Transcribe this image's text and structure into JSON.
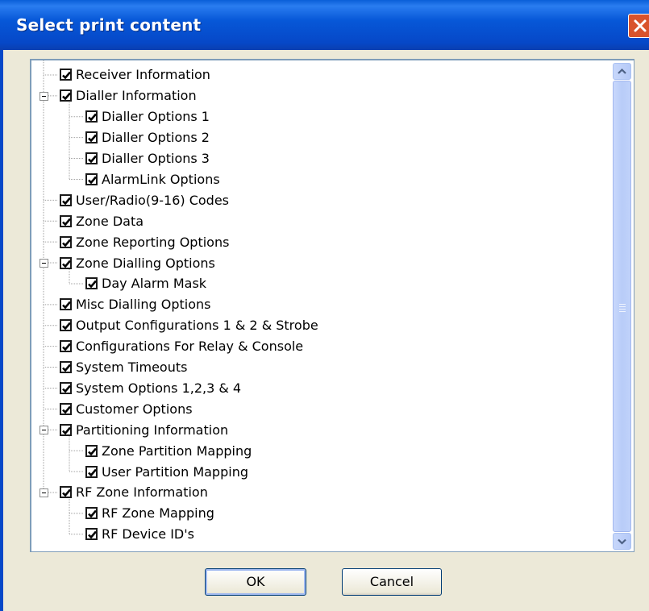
{
  "dialog": {
    "title": "Select print content",
    "ok_label": "OK",
    "cancel_label": "Cancel"
  },
  "icons": {
    "close": "close-icon",
    "checkbox": "checkmark-icon",
    "expander": "minus-icon",
    "scroll_up": "chevron-up-icon",
    "scroll_down": "chevron-down-icon"
  },
  "colors": {
    "titlebar": "#0648c8",
    "close_button": "#d9532c",
    "dialog_bg": "#ece9d8",
    "tree_border": "#7f9db9"
  },
  "tree": {
    "items": [
      {
        "label": "Receiver Information",
        "level": 0,
        "checked": true,
        "expanded": false
      },
      {
        "label": "Dialler Information",
        "level": 0,
        "checked": true,
        "expanded": true
      },
      {
        "label": "Dialler Options 1",
        "level": 1,
        "checked": true,
        "expanded": false
      },
      {
        "label": "Dialler Options 2",
        "level": 1,
        "checked": true,
        "expanded": false
      },
      {
        "label": "Dialler Options 3",
        "level": 1,
        "checked": true,
        "expanded": false
      },
      {
        "label": "AlarmLink Options",
        "level": 1,
        "checked": true,
        "expanded": false
      },
      {
        "label": "User/Radio(9-16) Codes",
        "level": 0,
        "checked": true,
        "expanded": false
      },
      {
        "label": "Zone Data",
        "level": 0,
        "checked": true,
        "expanded": false
      },
      {
        "label": "Zone Reporting Options",
        "level": 0,
        "checked": true,
        "expanded": false
      },
      {
        "label": "Zone Dialling Options",
        "level": 0,
        "checked": true,
        "expanded": true
      },
      {
        "label": "Day Alarm Mask",
        "level": 1,
        "checked": true,
        "expanded": false
      },
      {
        "label": "Misc Dialling Options",
        "level": 0,
        "checked": true,
        "expanded": false
      },
      {
        "label": "Output Configurations 1 & 2  & Strobe",
        "level": 0,
        "checked": true,
        "expanded": false
      },
      {
        "label": "Configurations For Relay & Console",
        "level": 0,
        "checked": true,
        "expanded": false
      },
      {
        "label": "System Timeouts",
        "level": 0,
        "checked": true,
        "expanded": false
      },
      {
        "label": "System Options 1,2,3 & 4",
        "level": 0,
        "checked": true,
        "expanded": false
      },
      {
        "label": "Customer Options",
        "level": 0,
        "checked": true,
        "expanded": false
      },
      {
        "label": "Partitioning Information",
        "level": 0,
        "checked": true,
        "expanded": true
      },
      {
        "label": "Zone Partition Mapping",
        "level": 1,
        "checked": true,
        "expanded": false
      },
      {
        "label": "User Partition Mapping",
        "level": 1,
        "checked": true,
        "expanded": false
      },
      {
        "label": "RF Zone Information",
        "level": 0,
        "checked": true,
        "expanded": true
      },
      {
        "label": "RF Zone Mapping",
        "level": 1,
        "checked": true,
        "expanded": false
      },
      {
        "label": "RF Device ID's",
        "level": 1,
        "checked": true,
        "expanded": false
      }
    ]
  }
}
